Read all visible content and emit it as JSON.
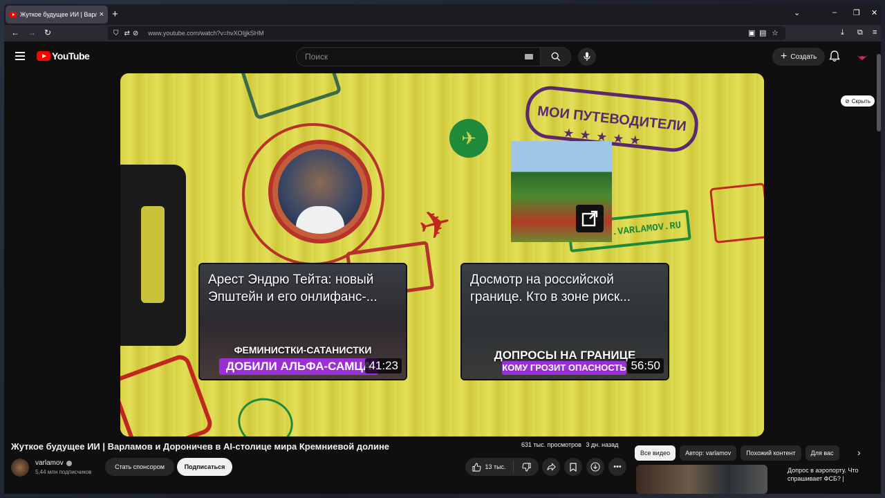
{
  "browser": {
    "tab_title": "Жуткое будущее ИИ | Варламов",
    "tab_close": "×",
    "new_tab": "+",
    "url": "www.youtube.com/watch?v=hvXOIjjkSHM"
  },
  "youtube": {
    "logo_text": "YouTube",
    "search_placeholder": "Поиск",
    "create_label": "Создать",
    "hide_label": "Скрыть"
  },
  "player": {
    "stamp_guides": "МОИ ПУТЕВОДИТЕЛИ",
    "stamp_travel": "TRAVEL.VARLAMOV.RU",
    "endscreen_videos": [
      {
        "title": "Арест Эндрю Тейта: новый Эпштейн и его онлифанс-...",
        "thumb_caption_top": "ФЕМИНИСТКИ-САТАНИСТКИ",
        "thumb_caption_band": "ДОБИЛИ АЛЬФА-САМЦА",
        "duration": "41:23"
      },
      {
        "title": "Досмотр на российской границе. Кто в зоне риск...",
        "thumb_caption_top": "ДОПРОСЫ НА ГРАНИЦЕ",
        "thumb_caption_band": "КОМУ ГРОЗИТ ОПАСНОСТЬ",
        "duration": "56:50"
      }
    ]
  },
  "video": {
    "title": "Жуткое будущее ИИ | Варламов и Дороничев в AI-столице мира Кремниевой долине",
    "views": "631 тыс. просмотров",
    "age": "3 дн. назад",
    "channel_name": "varlamov",
    "channel_subs": "5,44 млн подписчиков",
    "sponsor_label": "Стать спонсором",
    "subscribe_label": "Подписаться",
    "likes": "13 тыс."
  },
  "sidebar": {
    "chips": [
      "Все видео",
      "Автор: varlamov",
      "Похожий контент",
      "Для вас"
    ],
    "rec_title": "Допрос в аэропорту. Что спрашивает ФСБ? |"
  }
}
